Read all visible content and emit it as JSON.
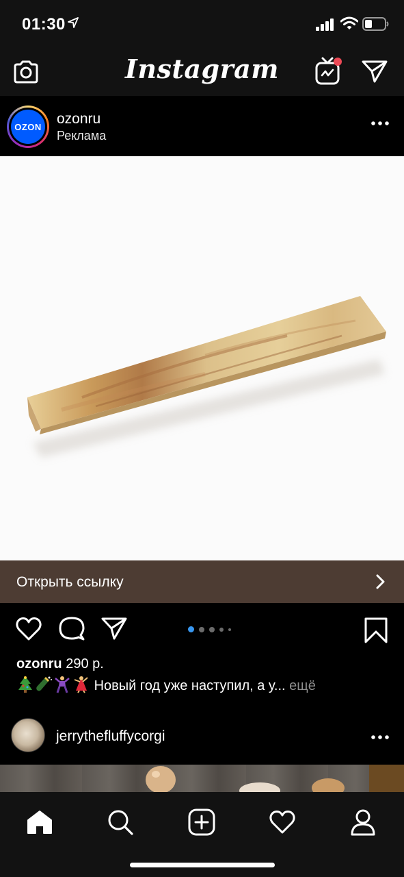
{
  "status_bar": {
    "time": "01:30"
  },
  "header": {
    "app_title": "Instagram"
  },
  "post": {
    "username": "ozonru",
    "sponsored_label": "Реклама",
    "avatar_text": "OZON",
    "cta_label": "Открыть ссылку",
    "carousel": {
      "total": 5,
      "active_index": 0
    },
    "likes_user": "ozonru",
    "likes_text": "290 р.",
    "caption_text": "Новый год уже наступил, а у...",
    "caption_more": "ещё"
  },
  "next_post": {
    "username": "jerrythefluffycorgi"
  },
  "colors": {
    "cta_bg": "#4d3c33",
    "accent_blue": "#3897f0",
    "ozon_blue": "#005bff",
    "notification_red": "#ed4956"
  },
  "tabs": [
    {
      "icon": "home-icon"
    },
    {
      "icon": "search-icon"
    },
    {
      "icon": "add-post-icon"
    },
    {
      "icon": "activity-heart-icon"
    },
    {
      "icon": "profile-icon"
    }
  ]
}
